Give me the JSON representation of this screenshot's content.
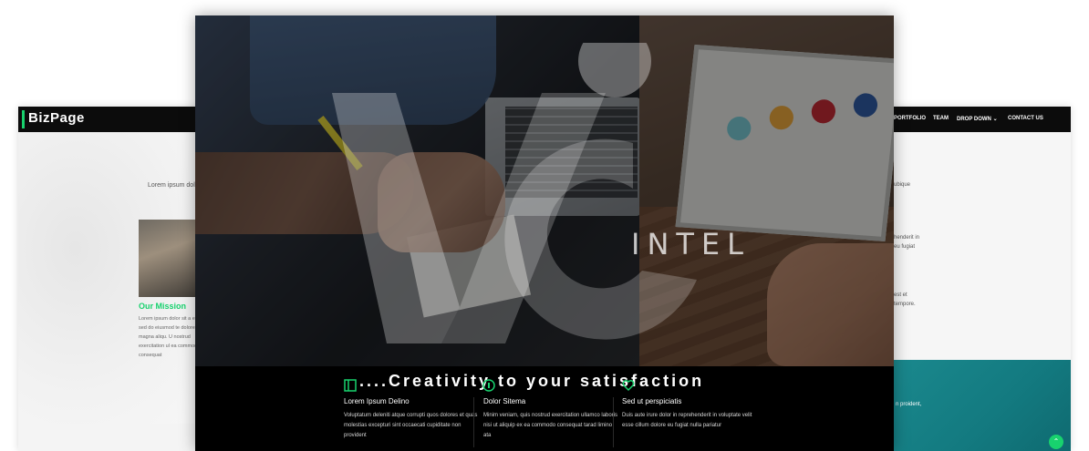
{
  "left_card": {
    "brand": "BizPage",
    "intro": "Lorem ipsum dolo",
    "mission_title": "Our Mission",
    "mission_text": "Lorem ipsum dolor sit a elit, sed do eiusmod te dolore magna aliqu. U nostrud exercitation ul ea commodo consequat"
  },
  "right_card": {
    "nav": [
      "PORTFOLIO",
      "TEAM",
      "DROP DOWN",
      "CONTACT US"
    ],
    "lines": [
      "ubique",
      "henderit in",
      "eu fugiat",
      "est et",
      "tempore."
    ],
    "teal_text": "n proident,",
    "up_icon": "chevron-up-icon"
  },
  "hero": {
    "watermark_text": "INTEL",
    "tagline": "....Creativity to your satisfaction",
    "features": [
      {
        "title": "Lorem Ipsum Delino",
        "text": "Voluptatum deleniti atque corrupti quos dolores et quas molestias excepturi sint occaecati cupiditate non provident",
        "icon": "document-icon"
      },
      {
        "title": "Dolor Sitema",
        "text": "Minim veniam, quis nostrud exercitation ullamco laboris nisi ut aliquip ex ea commodo consequat tarad limino ata",
        "icon": "bar-chart-icon"
      },
      {
        "title": "Sed ut perspiciatis",
        "text": "Duis aute irure dolor in reprehenderit in voluptate velit esse cillum dolore eu fugiat nulla pariatur",
        "icon": "heart-icon"
      }
    ]
  },
  "colors": {
    "accent": "#18d26e",
    "navbar": "#0c0c0c",
    "teal": "#1b8a8f"
  }
}
